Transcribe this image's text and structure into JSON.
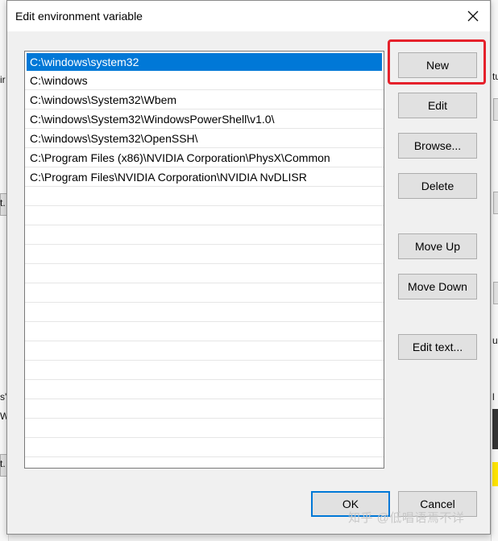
{
  "dialog": {
    "title": "Edit environment variable",
    "close_icon": "close-icon"
  },
  "paths": [
    "C:\\windows\\system32",
    "C:\\windows",
    "C:\\windows\\System32\\Wbem",
    "C:\\windows\\System32\\WindowsPowerShell\\v1.0\\",
    "C:\\windows\\System32\\OpenSSH\\",
    "C:\\Program Files (x86)\\NVIDIA Corporation\\PhysX\\Common",
    "C:\\Program Files\\NVIDIA Corporation\\NVIDIA NvDLISR"
  ],
  "selected_index": 0,
  "buttons": {
    "new": "New",
    "edit": "Edit",
    "browse": "Browse...",
    "delete": "Delete",
    "move_up": "Move Up",
    "move_down": "Move Down",
    "edit_text": "Edit text...",
    "ok": "OK",
    "cancel": "Cancel"
  },
  "highlight_color": "#e5212b",
  "accent_color": "#0078d7",
  "watermark": "知乎 @低唱语焉不详",
  "background_fragments": {
    "left": [
      "ir",
      "t.",
      "s'",
      "W",
      "t."
    ],
    "right": [
      "tu",
      "u",
      "l"
    ]
  }
}
